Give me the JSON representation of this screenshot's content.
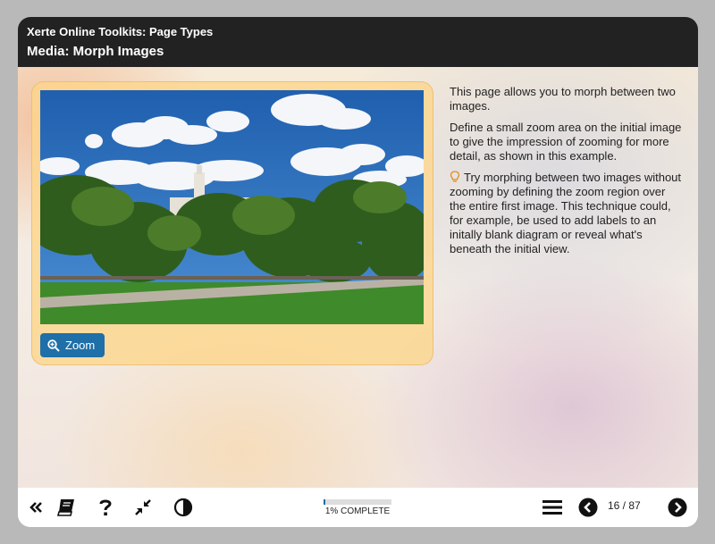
{
  "header": {
    "app_title": "Xerte Online Toolkits: Page Types",
    "page_title": "Media: Morph Images"
  },
  "main": {
    "image": {
      "description_icon": "photo-icon"
    },
    "zoom_button": {
      "label": "Zoom",
      "icon": "zoom-in-icon"
    },
    "text": {
      "para1": "This page allows you to morph between two images.",
      "para2": "Define a small zoom area on the initial image to give the impression of zooming for more detail, as shown in this example.",
      "tip": "Try morphing between two images without zooming by defining the zoom region over the entire first image. This technique could, for example, be used to add labels to an initally blank diagram or reveal what's beneath the initial view.",
      "tip_icon": "lightbulb-icon"
    }
  },
  "footer": {
    "buttons_left": [
      "collapse-icon",
      "glossary-book-icon",
      "help-icon",
      "minimize-icon",
      "contrast-icon"
    ],
    "progress": {
      "label": "1% COMPLETE",
      "value": 0.01
    },
    "page_count": "16 / 87",
    "buttons_right": [
      "menu-icon",
      "previous-icon",
      "next-icon"
    ]
  },
  "colors": {
    "header_bg": "#222222",
    "accent_blue": "#1f6fa8",
    "panel_orange": "#fcd68c"
  }
}
